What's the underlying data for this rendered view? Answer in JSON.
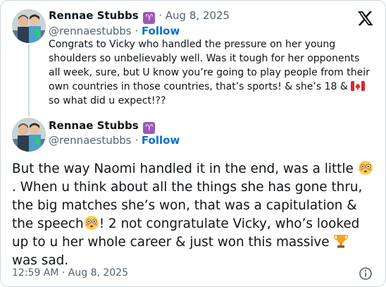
{
  "quoted_tweet": {
    "author_name": "Rennae Stubbs",
    "zodiac_symbol": "♈",
    "separator": "·",
    "date": "Aug 8, 2025",
    "handle": "@rennaestubbs",
    "follow_label": "Follow",
    "text_before_flag": "Congrats to Vicky who handled the pressure on her young shoulders so unbelievably well. Was it tough for her opponents all week, sure, but U know you’re going to play people from their own countries in those countries, that’s sports! & she’s 18 & ",
    "text_after_flag": " so what did u expect!??"
  },
  "main_tweet": {
    "author_name": "Rennae Stubbs",
    "zodiac_symbol": "♈",
    "handle": "@rennaestubbs",
    "separator": "·",
    "follow_label": "Follow",
    "text_part1": "But the way Naomi handled it in the end, was a little ",
    "text_part2": " . When u think about all the things she has gone thru, the big matches she’s won, that was a capitulation & the speech",
    "text_part3": "!  2 not congratulate Vicky, who’s looked up to u her whole career & just won this massive ",
    "text_part4": " was sad.",
    "timestamp": "12:59 AM · Aug 8, 2025"
  },
  "icons": {
    "brand": "x-logo-icon",
    "info": "info-icon",
    "flag": "canada-flag-icon",
    "flushed": "flushed-face-icon",
    "trophy": "trophy-icon",
    "zodiac": "aries-icon"
  },
  "colors": {
    "follow": "#006fd6",
    "secondary_text": "#536471",
    "border": "#cfd9de",
    "zodiac_bg": "#9b59b6"
  }
}
